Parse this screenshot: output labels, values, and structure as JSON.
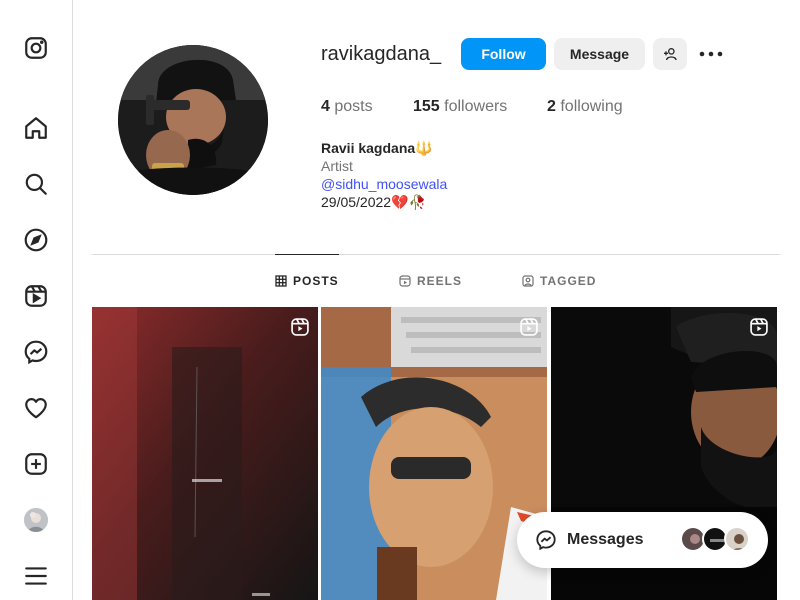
{
  "profile": {
    "username": "ravikagdana_",
    "follow_label": "Follow",
    "message_label": "Message",
    "posts_count": "4",
    "posts_label": "posts",
    "followers_count": "155",
    "followers_label": "followers",
    "following_count": "2",
    "following_label": "following",
    "full_name": "Ravii kagdana🔱",
    "category": "Artist",
    "mention": "@sidhu_moosewala",
    "date_line": "29/05/2022💔🥀"
  },
  "tabs": [
    {
      "label": "POSTS",
      "icon": "grid-icon",
      "active": true
    },
    {
      "label": "REELS",
      "icon": "reels-icon",
      "active": false
    },
    {
      "label": "TAGGED",
      "icon": "tagged-icon",
      "active": false
    }
  ],
  "posts": [
    {
      "type": "reel",
      "icon": "reel-icon"
    },
    {
      "type": "reel",
      "icon": "reel-icon"
    },
    {
      "type": "reel",
      "icon": "reel-icon"
    }
  ],
  "sidebar": {
    "items": [
      {
        "icon": "instagram-logo-icon"
      },
      {
        "icon": "home-icon"
      },
      {
        "icon": "search-icon"
      },
      {
        "icon": "explore-compass-icon"
      },
      {
        "icon": "reels-icon"
      },
      {
        "icon": "messenger-icon"
      },
      {
        "icon": "heart-icon"
      },
      {
        "icon": "create-plus-icon"
      },
      {
        "icon": "profile-avatar"
      },
      {
        "icon": "menu-hamburger-icon"
      }
    ]
  },
  "messages": {
    "label": "Messages"
  },
  "colors": {
    "accent": "#0095f6",
    "link": "#4150f7",
    "border": "#dbdbdb",
    "button_bg": "#efefef"
  }
}
